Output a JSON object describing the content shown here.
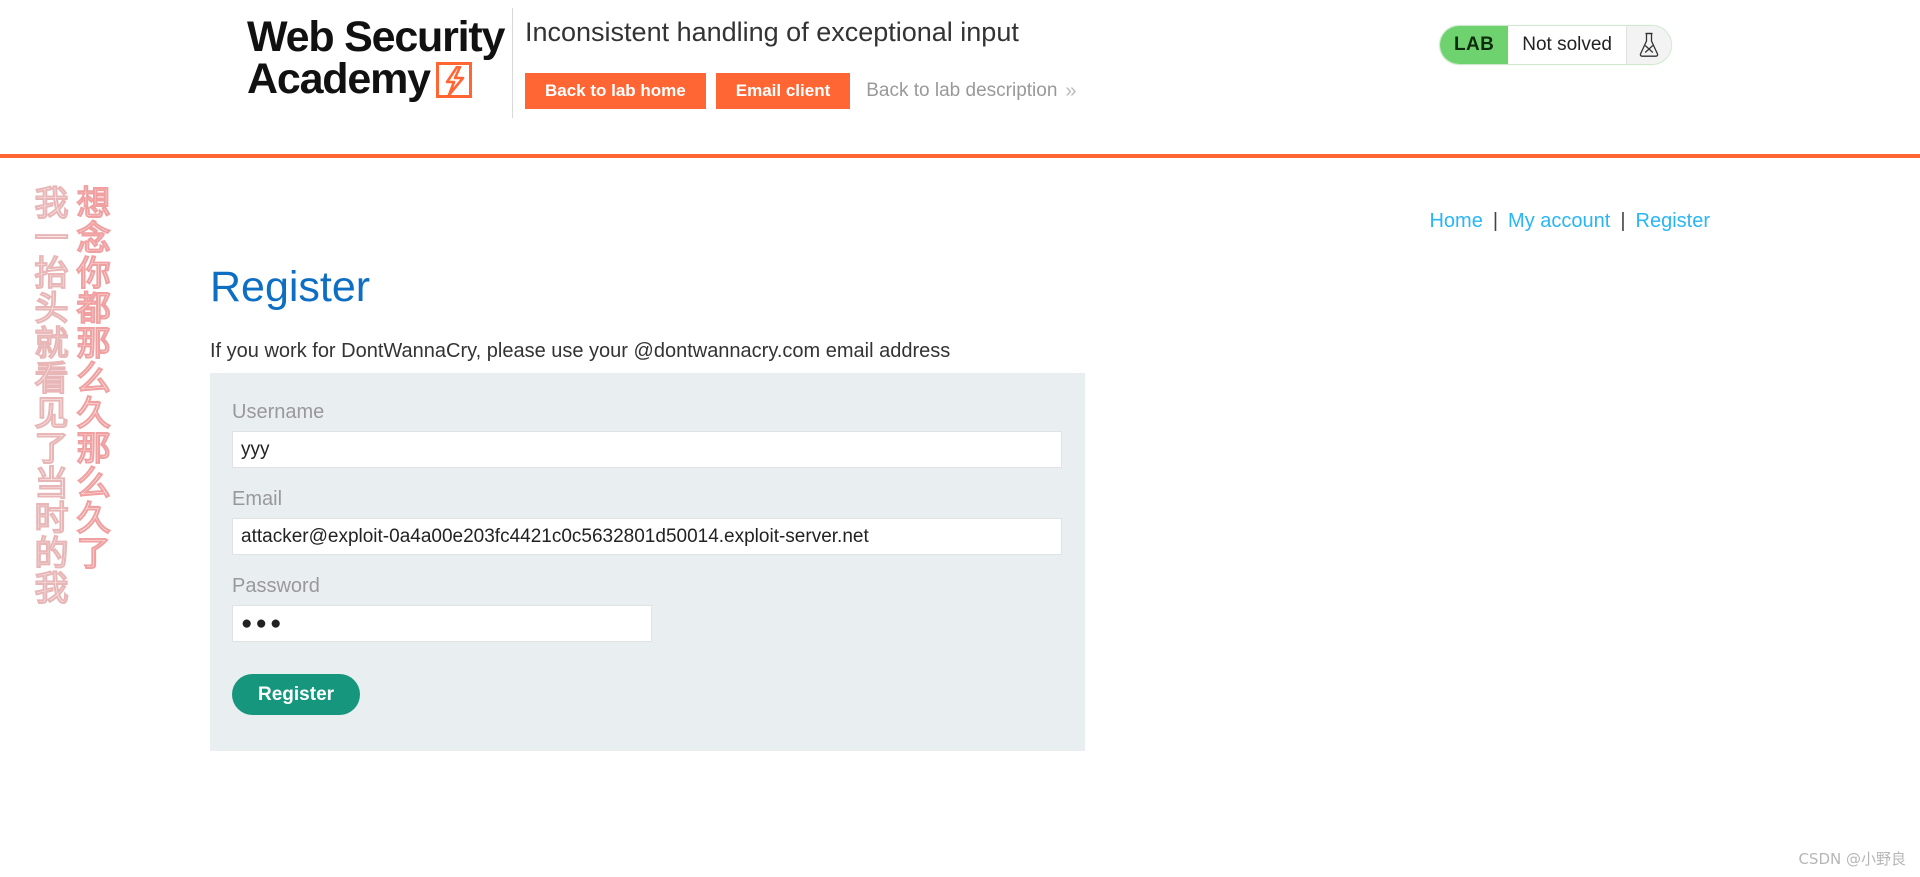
{
  "header": {
    "logo_line1": "Web Security",
    "logo_line2": "Academy",
    "logo_icon": "lightning-bolt-icon",
    "lab_title": "Inconsistent handling of exceptional input",
    "buttons": {
      "back_to_lab_home": "Back to lab home",
      "email_client": "Email client",
      "back_to_lab_description": "Back to lab description",
      "back_chevron": "»"
    },
    "lab_status": {
      "tag": "LAB",
      "state": "Not solved",
      "icon": "flask-not-solved-icon",
      "tag_color": "#6ed36e"
    }
  },
  "nav": {
    "items": [
      {
        "label": "Home"
      },
      {
        "label": "My account"
      },
      {
        "label": "Register"
      }
    ],
    "separator": "|",
    "link_color": "#29b6f6"
  },
  "main": {
    "heading": "Register",
    "subtext": "If you work for DontWannaCry, please use your @dontwannacry.com email address",
    "form": {
      "username": {
        "label": "Username",
        "value": "yyy",
        "placeholder": ""
      },
      "email": {
        "label": "Email",
        "value": "attacker@exploit-0a4a00e203fc4421c0c5632801d50014.exploit-server.net",
        "placeholder": ""
      },
      "password": {
        "label": "Password",
        "value": "●●●",
        "placeholder": ""
      },
      "submit_label": "Register",
      "submit_color": "#16967c",
      "panel_color": "#e9eef1"
    }
  },
  "watermark": {
    "column_right": "想念你都那么久那么久了",
    "column_left": "我一抬头就看见了当时的我",
    "color": "#f0a0a0"
  },
  "footer": {
    "csdn_credit": "CSDN @小野良"
  },
  "theme": {
    "accent_orange": "#ff6633",
    "heading_blue": "#0d6ec4",
    "link_blue": "#29b6f6",
    "button_green": "#16967c"
  }
}
